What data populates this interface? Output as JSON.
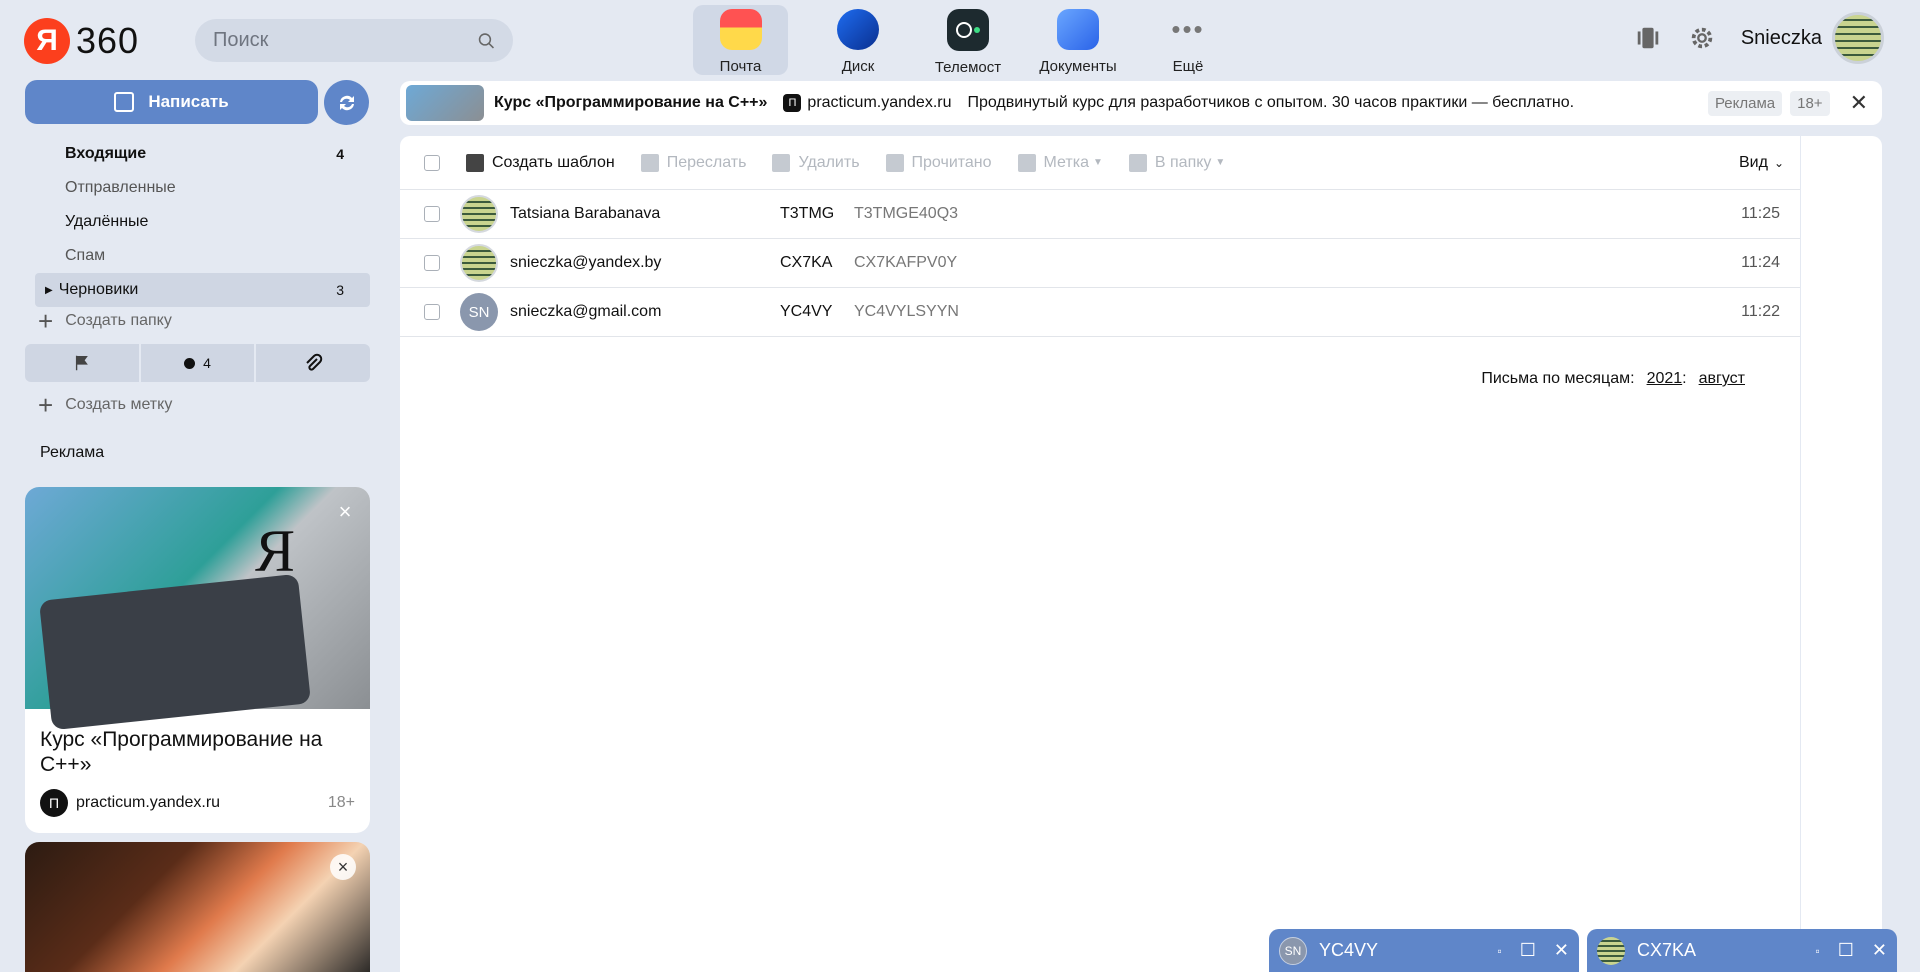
{
  "header": {
    "logo_letter": "Я",
    "logo_text": "360",
    "search_placeholder": "Поиск",
    "apps": [
      {
        "label": "Почта",
        "icon": "mail-icon"
      },
      {
        "label": "Диск",
        "icon": "disk-icon"
      },
      {
        "label": "Телемост",
        "icon": "telemost-icon"
      },
      {
        "label": "Документы",
        "icon": "docs-icon"
      },
      {
        "label": "Ещё",
        "icon": "more-icon"
      }
    ],
    "username": "Snieczka"
  },
  "sidebar": {
    "compose_label": "Написать",
    "folders": [
      {
        "label": "Входящие",
        "count": "4"
      },
      {
        "label": "Отправленные",
        "count": ""
      },
      {
        "label": "Удалённые",
        "count": ""
      },
      {
        "label": "Спам",
        "count": ""
      },
      {
        "label": "Черновики",
        "count": "3"
      }
    ],
    "create_folder": "Создать папку",
    "filter_unread_count": "4",
    "create_label": "Создать метку",
    "ad_heading": "Реклама",
    "ad_card": {
      "title": "Курс «Программирование на С++»",
      "source": "practicum.yandex.ru",
      "age": "18+"
    }
  },
  "banner": {
    "title": "Курс «Программирование на С++»",
    "source": "practicum.yandex.ru",
    "text": "Продвинутый курс для разработчиков с опытом. 30 часов практики — бесплатно.",
    "tag": "Реклама",
    "age": "18+"
  },
  "toolbar": {
    "create_template": "Создать шаблон",
    "forward": "Переслать",
    "delete": "Удалить",
    "read": "Прочитано",
    "label": "Метка",
    "to_folder": "В папку",
    "view": "Вид"
  },
  "messages": [
    {
      "from": "Tatsiana Barabanava",
      "subject": "T3TMG",
      "preview": "T3TMGE40Q3",
      "time": "11:25",
      "avatar": "image"
    },
    {
      "from": "snieczka@yandex.by",
      "subject": "CX7KA",
      "preview": "CX7KAFPV0Y",
      "time": "11:24",
      "avatar": "image"
    },
    {
      "from": "snieczka@gmail.com",
      "subject": "YC4VY",
      "preview": "YC4VYLSYYN",
      "time": "11:22",
      "avatar": "SN"
    }
  ],
  "months": {
    "label": "Письма по месяцам:",
    "year": "2021",
    "month": "август"
  },
  "compose_tabs": [
    {
      "title": "YC4VY",
      "avatar": "SN"
    },
    {
      "title": "CX7KA",
      "avatar": "image"
    }
  ],
  "colors": {
    "accent": "#5f86c9",
    "background": "#e4e9f2",
    "yandex_red": "#fc3f1d"
  }
}
